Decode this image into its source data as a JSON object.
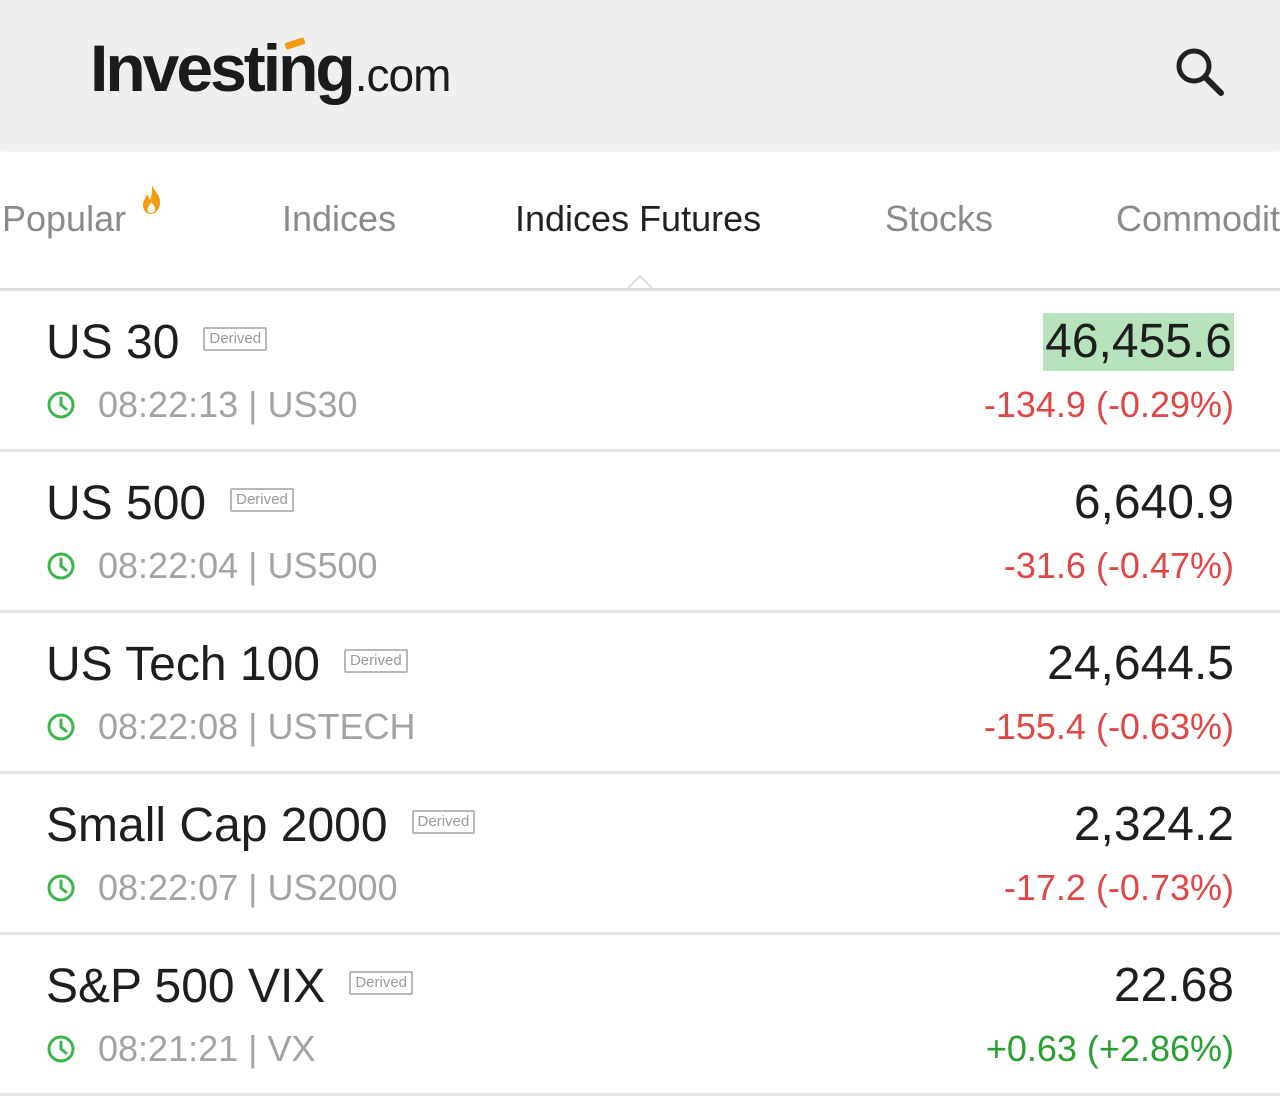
{
  "header": {
    "logo_main": "Investing",
    "logo_suffix": ".com",
    "logo_accent_color": "#f39c12",
    "search_icon": "search-icon"
  },
  "tabs": [
    {
      "label": "Popular",
      "icon": "flame-icon",
      "active": false
    },
    {
      "label": "Indices",
      "active": false
    },
    {
      "label": "Indices Futures",
      "active": true
    },
    {
      "label": "Stocks",
      "active": false
    },
    {
      "label": "Commodit",
      "active": false
    }
  ],
  "colors": {
    "negative": "#e04646",
    "positive": "#27a02f",
    "highlight": "#b6e3bb",
    "clock": "#3cb54a"
  },
  "rows": [
    {
      "name": "US 30",
      "badge": "Derived",
      "time_symbol": "08:22:13 | US30",
      "price": "46,455.6",
      "change": "-134.9 (-0.29%)",
      "direction": "neg",
      "highlight": true
    },
    {
      "name": "US 500",
      "badge": "Derived",
      "time_symbol": "08:22:04 | US500",
      "price": "6,640.9",
      "change": "-31.6 (-0.47%)",
      "direction": "neg",
      "highlight": false
    },
    {
      "name": "US Tech 100",
      "badge": "Derived",
      "time_symbol": "08:22:08 | USTECH",
      "price": "24,644.5",
      "change": "-155.4 (-0.63%)",
      "direction": "neg",
      "highlight": false
    },
    {
      "name": "Small Cap 2000",
      "badge": "Derived",
      "time_symbol": "08:22:07 | US2000",
      "price": "2,324.2",
      "change": "-17.2 (-0.73%)",
      "direction": "neg",
      "highlight": false
    },
    {
      "name": "S&P 500 VIX",
      "badge": "Derived",
      "time_symbol": "08:21:21 | VX",
      "price": "22.68",
      "change": "+0.63 (+2.86%)",
      "direction": "pos",
      "highlight": false
    }
  ]
}
